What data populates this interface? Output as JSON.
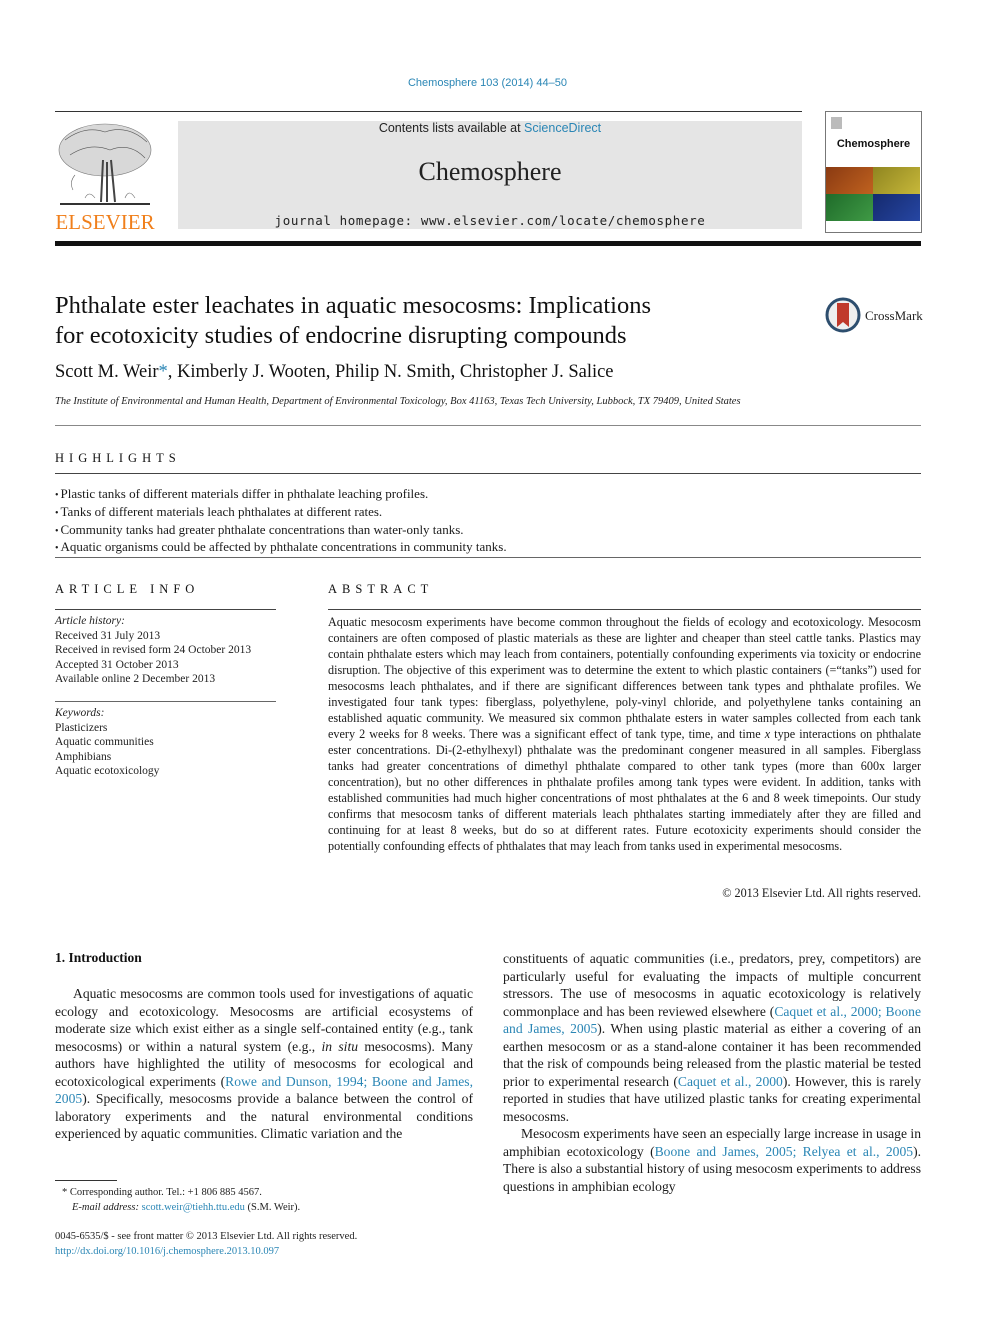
{
  "header": {
    "journal_ref": "Chemosphere 103 (2014) 44–50",
    "publisher_logo_text": "ELSEVIER",
    "contents_prefix": "Contents lists available at ",
    "contents_link": "ScienceDirect",
    "journal_name": "Chemosphere",
    "homepage": "journal homepage: www.elsevier.com/locate/chemosphere",
    "cover_title": "Chemosphere",
    "colors": {
      "link": "#2a86b5",
      "elsevier_orange": "#f07f1b",
      "banner_gray": "#e5e5e5",
      "cover_orange": "#b5551f",
      "cover_yellow": "#b7a92a",
      "cover_green": "#2f8a3a",
      "cover_blue": "#1e3b8f",
      "crossmark_red": "#c0392b"
    }
  },
  "article": {
    "title_line1": "Phthalate ester leachates in aquatic mesocosms: Implications",
    "title_line2": "for ecotoxicity studies of endocrine disrupting compounds",
    "crossmark_label": "CrossMark",
    "authors": {
      "first": "Scott M. Weir",
      "star": "*",
      "rest": ", Kimberly J. Wooten, Philip N. Smith, Christopher J. Salice"
    },
    "affiliation": "The Institute of Environmental and Human Health, Department of Environmental Toxicology, Box 41163, Texas Tech University, Lubbock, TX 79409, United States"
  },
  "highlights": {
    "heading": "HIGHLIGHTS",
    "items": [
      "Plastic tanks of different materials differ in phthalate leaching profiles.",
      "Tanks of different materials leach phthalates at different rates.",
      "Community tanks had greater phthalate concentrations than water-only tanks.",
      "Aquatic organisms could be affected by phthalate concentrations in community tanks."
    ]
  },
  "article_info": {
    "heading": "ARTICLE INFO",
    "history_label": "Article history:",
    "history": [
      "Received 31 July 2013",
      "Received in revised form 24 October 2013",
      "Accepted 31 October 2013",
      "Available online 2 December 2013"
    ],
    "keywords_label": "Keywords:",
    "keywords": [
      "Plasticizers",
      "Aquatic communities",
      "Amphibians",
      "Aquatic ecotoxicology"
    ]
  },
  "abstract": {
    "heading": "ABSTRACT",
    "part1": "Aquatic mesocosm experiments have become common throughout the fields of ecology and ecotoxicology. Mesocosm containers are often composed of plastic materials as these are lighter and cheaper than steel cattle tanks. Plastics may contain phthalate esters which may leach from containers, potentially confounding experiments via toxicity or endocrine disruption. The objective of this experiment was to determine the extent to which plastic containers (=“tanks”) used for mesocosms leach phthalates, and if there are significant differences between tank types and phthalate profiles. We investigated four tank types: fiberglass, polyethylene, poly-vinyl chloride, and polyethylene tanks containing an established aquatic community. We measured six common phthalate esters in water samples collected from each tank every 2 weeks for 8 weeks. There was a significant effect of tank type, time, and time ",
    "italic_x": "x",
    "part2": " type interactions on phthalate ester concentrations. Di-(2-ethylhexyl) phthalate was the predominant congener measured in all samples. Fiberglass tanks had greater concentrations of dimethyl phthalate compared to other tank types (more than 600x larger concentration), but no other differences in phthalate profiles among tank types were evident. In addition, tanks with established communities had much higher concentrations of most phthalates at the 6 and 8 week timepoints. Our study confirms that mesocosm tanks of different materials leach phthalates starting immediately after they are filled and continuing for at least 8 weeks, but do so at different rates. Future ecotoxicity experiments should consider the potentially confounding effects of phthalates that may leach from tanks used in experimental mesocosms.",
    "copyright": "© 2013 Elsevier Ltd. All rights reserved."
  },
  "body": {
    "section_heading": "1. Introduction",
    "left": {
      "p1_a": "Aquatic mesocosms are common tools used for investigations of aquatic ecology and ecotoxicology. Mesocosms are artificial ecosystems of moderate size which exist either as a single self-contained entity (e.g., tank mesocosms) or within a natural system (e.g., ",
      "p1_italic": "in situ",
      "p1_b": " mesocosms). Many authors have highlighted the utility of mesocosms for ecological and ecotoxicological experiments (",
      "p1_cite": "Rowe and Dunson, 1994; Boone and James, 2005",
      "p1_c": "). Specifically, mesocosms provide a balance between the control of laboratory experiments and the natural environmental conditions experienced by aquatic communities. Climatic variation and the"
    },
    "right": {
      "p1_a": "constituents of aquatic communities (i.e., predators, prey, competitors) are particularly useful for evaluating the impacts of multiple concurrent stressors. The use of mesocosms in aquatic ecotoxicology is relatively commonplace and has been reviewed elsewhere (",
      "p1_cite1": "Caquet et al., 2000; Boone and James, 2005",
      "p1_b": "). When using plastic material as either a covering of an earthen mesocosm or as a stand-alone container it has been recommended that the risk of compounds being released from the plastic material be tested prior to experimental research (",
      "p1_cite2": "Caquet et al., 2000",
      "p1_c": "). However, this is rarely reported in studies that have utilized plastic tanks for creating experimental mesocosms.",
      "p2_a": "Mesocosm experiments have seen an especially large increase in usage in amphibian ecotoxicology (",
      "p2_cite": "Boone and James, 2005; Relyea et al., 2005",
      "p2_b": "). There is also a substantial history of using mesocosm experiments to address questions in amphibian ecology"
    }
  },
  "footnotes": {
    "corresponding": "*  Corresponding author. Tel.: +1 806 885 4567.",
    "email_label": "E-mail address: ",
    "email": "scott.weir@tiehh.ttu.edu",
    "email_suffix": " (S.M. Weir).",
    "front_matter": "0045-6535/$ - see front matter © 2013 Elsevier Ltd. All rights reserved.",
    "doi": "http://dx.doi.org/10.1016/j.chemosphere.2013.10.097"
  }
}
